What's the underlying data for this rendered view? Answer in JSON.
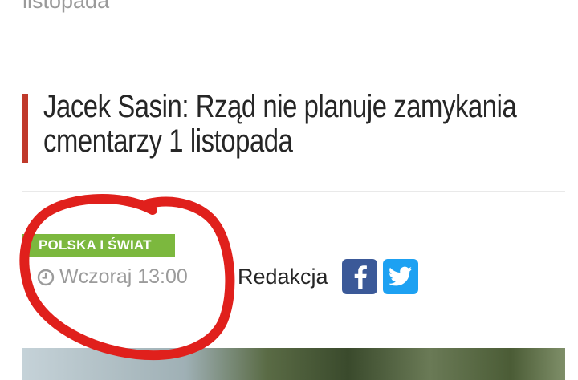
{
  "prev_article": {
    "title_tail": "listopada"
  },
  "article": {
    "title": "Jacek Sasin: Rząd nie planuje zamykania cmentarzy 1 listopada",
    "category": "POLSKA I ŚWIAT",
    "time": "Wczoraj 13:00",
    "author": "Redakcja"
  },
  "icons": {
    "clock": "clock-icon",
    "facebook": "facebook-icon",
    "twitter": "twitter-icon"
  },
  "colors": {
    "accent_bar": "#c0392b",
    "category_badge": "#7cb83e",
    "facebook": "#3b5998",
    "twitter": "#1da1f2",
    "annotation": "#e0201c"
  }
}
